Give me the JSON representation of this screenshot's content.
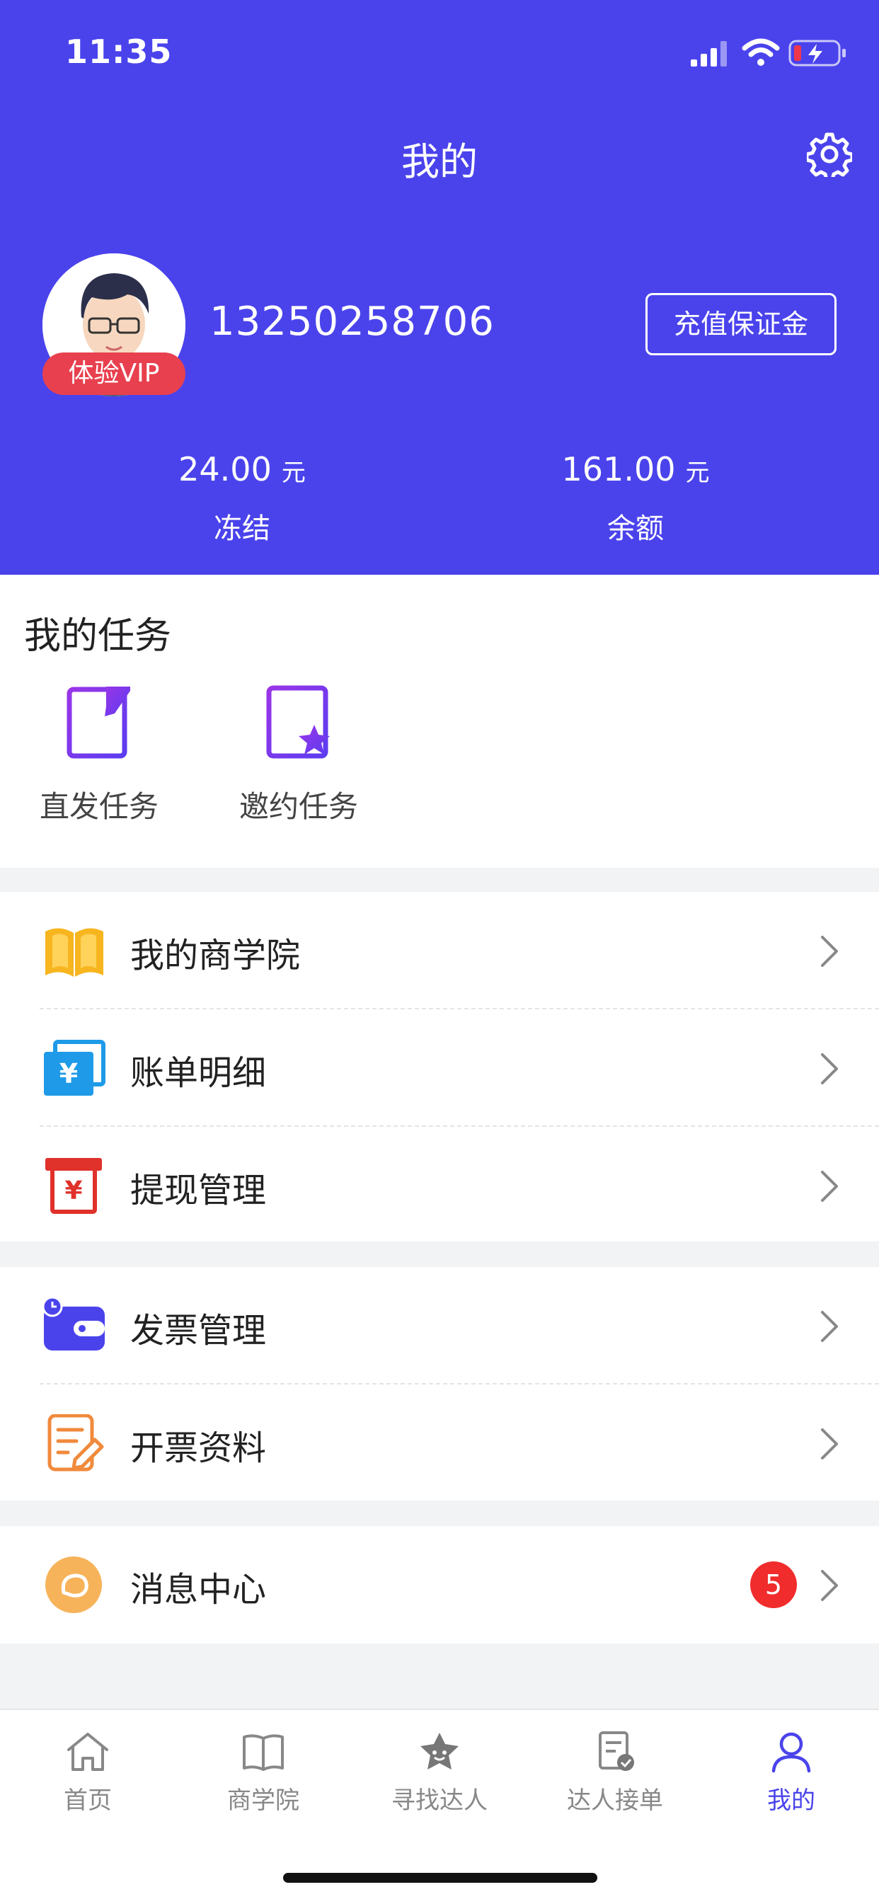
{
  "status_bar": {
    "time": "11:35"
  },
  "header": {
    "title": "我的",
    "phone": "13250258706",
    "vip_label": "体验VIP",
    "recharge_button": "充值保证金",
    "stats": [
      {
        "value": "24.00",
        "unit": "元",
        "label": "冻结"
      },
      {
        "value": "161.00",
        "unit": "元",
        "label": "余额"
      }
    ]
  },
  "tasks": {
    "title": "我的任务",
    "items": [
      {
        "label": "直发任务",
        "icon": "direct-task-icon"
      },
      {
        "label": "邀约任务",
        "icon": "invite-task-icon"
      }
    ]
  },
  "menu": {
    "group1": [
      {
        "label": "我的商学院",
        "icon": "book-icon"
      },
      {
        "label": "账单明细",
        "icon": "bill-icon"
      },
      {
        "label": "提现管理",
        "icon": "withdraw-icon"
      }
    ],
    "group2": [
      {
        "label": "发票管理",
        "icon": "invoice-wallet-icon"
      },
      {
        "label": "开票资料",
        "icon": "invoice-edit-icon"
      }
    ],
    "group3": [
      {
        "label": "消息中心",
        "icon": "message-icon",
        "badge": "5"
      }
    ]
  },
  "tabbar": {
    "items": [
      {
        "label": "首页",
        "icon": "home-icon",
        "active": false
      },
      {
        "label": "商学院",
        "icon": "open-book-icon",
        "active": false
      },
      {
        "label": "寻找达人",
        "icon": "star-face-icon",
        "active": false
      },
      {
        "label": "达人接单",
        "icon": "order-check-icon",
        "active": false
      },
      {
        "label": "我的",
        "icon": "user-icon",
        "active": true
      }
    ]
  },
  "colors": {
    "brand": "#4a43ec",
    "badge": "#f12c2c",
    "vip": "#e8404e"
  }
}
